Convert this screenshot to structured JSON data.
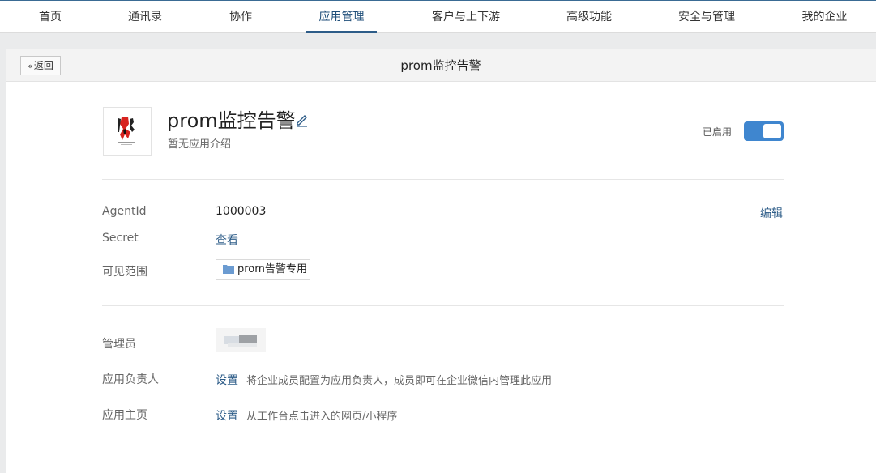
{
  "nav": {
    "items": [
      {
        "label": "首页"
      },
      {
        "label": "通讯录"
      },
      {
        "label": "协作"
      },
      {
        "label": "应用管理"
      },
      {
        "label": "客户与上下游"
      },
      {
        "label": "高级功能"
      },
      {
        "label": "安全与管理"
      },
      {
        "label": "我的企业"
      }
    ],
    "active": "应用管理"
  },
  "header": {
    "back_label": "返回",
    "title": "prom监控告警"
  },
  "app": {
    "name": "prom监控告警",
    "description": "暂无应用介绍",
    "status_label": "已启用",
    "enabled": true
  },
  "details": {
    "edit_label": "编辑",
    "agentid_label": "AgentId",
    "agentid_value": "1000003",
    "secret_label": "Secret",
    "secret_link": "查看",
    "scope_label": "可见范围",
    "scope_value": "prom告警专用"
  },
  "management": {
    "admin_label": "管理员",
    "owner_label": "应用负责人",
    "owner_link": "设置",
    "owner_hint": "将企业成员配置为应用负责人，成员即可在企业微信内管理此应用",
    "homepage_label": "应用主页",
    "homepage_link": "设置",
    "homepage_hint": "从工作台点击进入的网页/小程序"
  },
  "colors": {
    "accent": "#2d5c88",
    "toggle_on": "#3f86cf",
    "page_bg": "#eaebec"
  }
}
